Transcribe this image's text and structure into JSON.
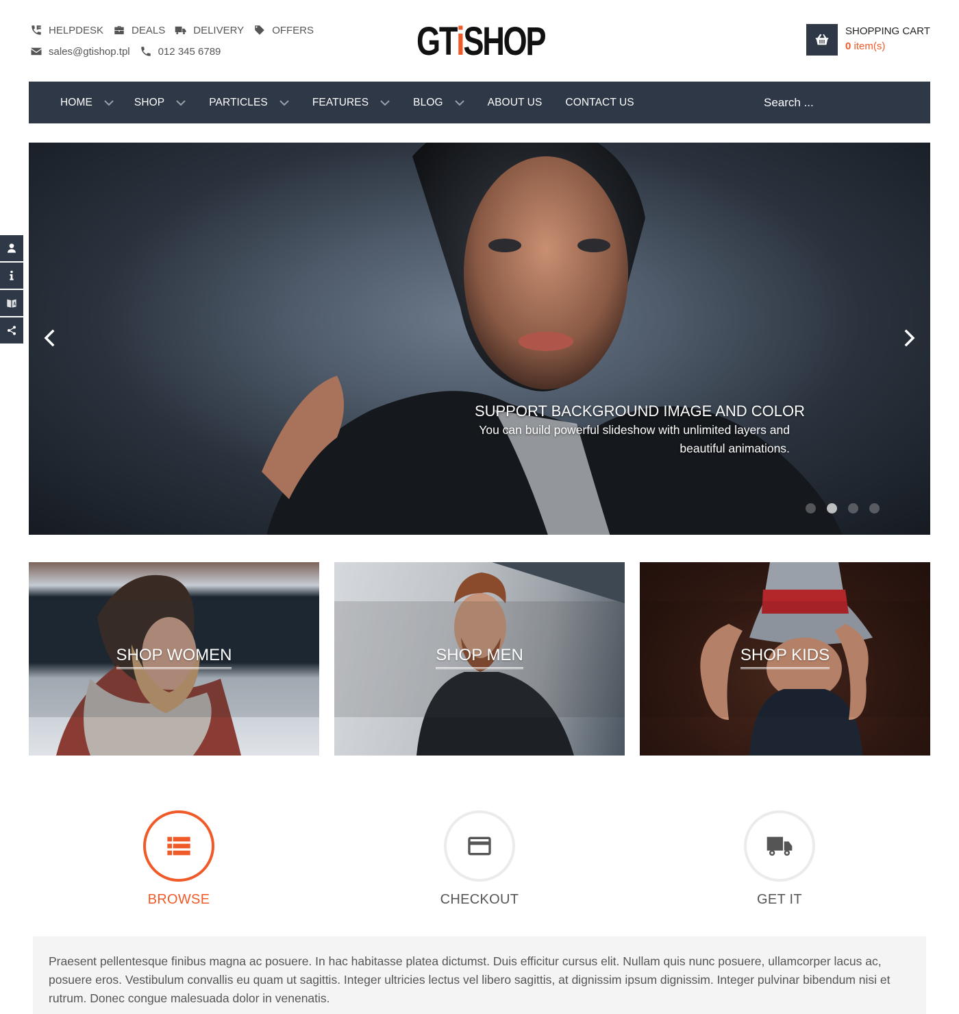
{
  "header": {
    "links": [
      {
        "icon": "phone-desk-icon",
        "label": "HELPDESK"
      },
      {
        "icon": "briefcase-icon",
        "label": "DEALS"
      },
      {
        "icon": "truck-icon",
        "label": "DELIVERY"
      },
      {
        "icon": "tag-icon",
        "label": "OFFERS"
      }
    ],
    "contact": {
      "email": "sales@gtishop.tpl",
      "phone": "012 345 6789"
    },
    "logo": {
      "prefix": "GT",
      "accent_letter": "i",
      "suffix": "SHOP",
      "accent_color": "#f05a28"
    },
    "cart": {
      "title": "SHOPPING CART",
      "count": "0",
      "count_suffix": " item(s)"
    }
  },
  "nav": {
    "items": [
      {
        "label": "HOME",
        "has_dropdown": true
      },
      {
        "label": "SHOP",
        "has_dropdown": true
      },
      {
        "label": "PARTICLES",
        "has_dropdown": true
      },
      {
        "label": "FEATURES",
        "has_dropdown": true
      },
      {
        "label": "BLOG",
        "has_dropdown": true
      },
      {
        "label": "ABOUT US",
        "has_dropdown": false
      },
      {
        "label": "CONTACT US",
        "has_dropdown": false
      }
    ],
    "search_placeholder": "Search ..."
  },
  "side_panel": {
    "buttons": [
      "user-icon",
      "info-icon",
      "language-icon",
      "share-icon"
    ]
  },
  "slider": {
    "heading": "SUPPORT BACKGROUND IMAGE AND COLOR",
    "text": "You can build powerful slideshow with unlimited layers and beautiful animations.",
    "slide_count": 4,
    "active_slide": 2
  },
  "categories": [
    {
      "label": "SHOP WOMEN"
    },
    {
      "label": "SHOP MEN"
    },
    {
      "label": "SHOP KIDS"
    }
  ],
  "steps": [
    {
      "label": "BROWSE",
      "icon": "list-icon",
      "active": true
    },
    {
      "label": "CHECKOUT",
      "icon": "credit-card-icon",
      "active": false
    },
    {
      "label": "GET IT",
      "icon": "truck-icon",
      "active": false
    }
  ],
  "colors": {
    "accent": "#f05a28",
    "nav_bg": "#2e3846",
    "text_block_bg": "#f4f4f4"
  },
  "text_block": "Praesent pellentesque finibus magna ac posuere. In hac habitasse platea dictumst. Duis efficitur cursus elit. Nullam quis nunc posuere, ullamcorper lacus ac, posuere eros. Vestibulum convallis eu quam ut sagittis. Integer ultricies lectus vel libero sagittis, at dignissim ipsum dignissim. Integer pulvinar bibendum nisi et rutrum. Donec congue malesuada dolor in venenatis."
}
